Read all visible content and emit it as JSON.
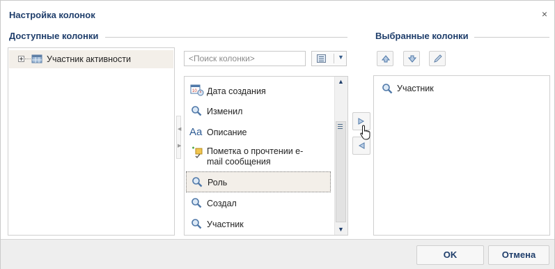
{
  "dialog": {
    "title": "Настройка колонок",
    "close_label": "×"
  },
  "available": {
    "title": "Доступные колонки",
    "tree": [
      {
        "label": "Участник активности",
        "expanded": false,
        "selected": true
      }
    ],
    "search_placeholder": "<Поиск колонки>",
    "items": [
      {
        "label": "Дата создания",
        "icon": "calendar-icon"
      },
      {
        "label": "Изменил",
        "icon": "magnifier-icon"
      },
      {
        "label": "Описание",
        "icon": "text-aa-icon"
      },
      {
        "label": "Пометка о прочтении e-\nmail сообщения",
        "icon": "checkbox-flag-icon"
      },
      {
        "label": "Роль",
        "icon": "magnifier-icon",
        "selected": true
      },
      {
        "label": "Создал",
        "icon": "magnifier-icon"
      },
      {
        "label": "Участник",
        "icon": "magnifier-icon"
      }
    ]
  },
  "selected": {
    "title": "Выбранные колонки",
    "items": [
      {
        "label": "Участник",
        "icon": "magnifier-icon"
      }
    ]
  },
  "footer": {
    "ok_label": "OK",
    "cancel_label": "Отмена"
  },
  "colors": {
    "title": "#1f3e6b",
    "selected_row": "#f3efe9",
    "footer": "#eeeeee"
  }
}
